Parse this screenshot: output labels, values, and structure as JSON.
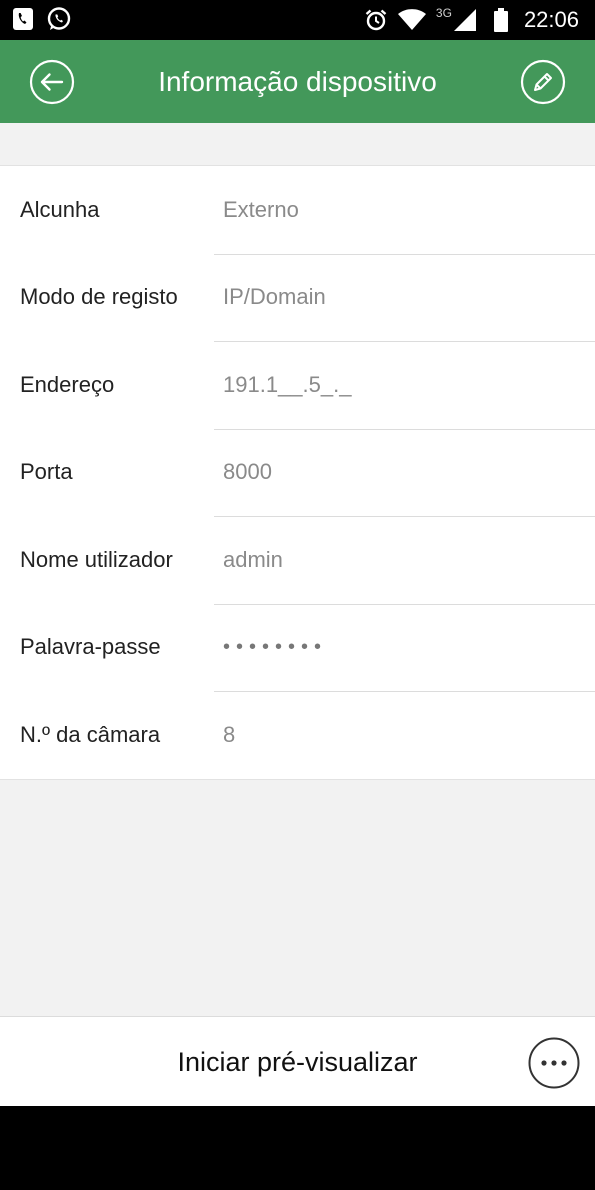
{
  "status_bar": {
    "time": "22:06",
    "network_label": "3G",
    "icons": [
      "phone-icon",
      "whatsapp-icon",
      "alarm-icon",
      "wifi-icon",
      "signal-icon",
      "battery-icon"
    ]
  },
  "header": {
    "title": "Informação dispositivo",
    "back_icon": "back-arrow-icon",
    "edit_icon": "pencil-icon",
    "background_color": "#43985a"
  },
  "device_info": {
    "fields": [
      {
        "label": "Alcunha",
        "value": "Externo"
      },
      {
        "label": "Modo de registo",
        "value": "IP/Domain"
      },
      {
        "label": "Endereço",
        "value": "191.1__.5_._"
      },
      {
        "label": "Porta",
        "value": "8000"
      },
      {
        "label": "Nome utilizador",
        "value": "admin"
      },
      {
        "label": "Palavra-passe",
        "value": "••••••••"
      },
      {
        "label": "N.º da câmara",
        "value": "8"
      }
    ]
  },
  "footer": {
    "start_preview_label": "Iniciar pré-visualizar",
    "more_icon": "more-options-icon"
  }
}
